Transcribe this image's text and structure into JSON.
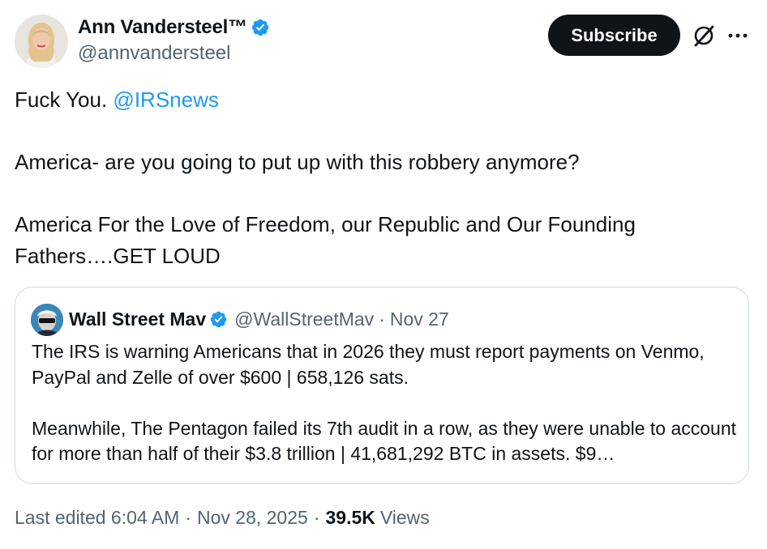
{
  "author": {
    "display_name": "Ann Vandersteel™",
    "handle": "@annvandersteel",
    "verified": true,
    "verified_color": "#1d9bf0"
  },
  "actions": {
    "subscribe_label": "Subscribe",
    "grok_icon": "grok-icon",
    "more_icon": "more-horizontal-icon"
  },
  "tweet": {
    "line1_prefix": "Fuck You. ",
    "line1_mention": "@IRSnews",
    "line2": "America- are you going to put up with this robbery anymore?",
    "line3": "America For the Love of Freedom, our Republic and Our Founding Fathers….GET LOUD"
  },
  "quote": {
    "display_name": "Wall Street Mav",
    "handle": "@WallStreetMav",
    "separator": "·",
    "date": "Nov 27",
    "verified": true,
    "paragraph1": "The IRS is warning Americans that in 2026 they must report payments on Venmo, PayPal and Zelle of over $600 | 658,126 sats.",
    "paragraph2": "Meanwhile, The Pentagon failed its 7th audit in a row, as they were unable to account for more than half of their $3.8 trillion | 41,681,292 BTC in assets. $9…"
  },
  "meta": {
    "edited_label": "Last edited 6:04 AM",
    "separator": "·",
    "date": "Nov 28, 2025",
    "views_count": "39.5K",
    "views_label": "Views"
  },
  "colors": {
    "text": "#0f1419",
    "secondary": "#536471",
    "link": "#1d9bf0",
    "border": "#cfd9de",
    "button_bg": "#0f1419",
    "button_text": "#ffffff"
  }
}
